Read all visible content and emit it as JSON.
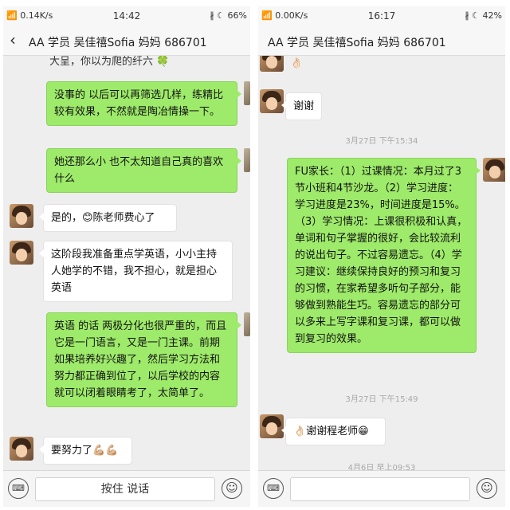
{
  "left": {
    "status": {
      "signal": "📶",
      "speed": "0.14K/s",
      "time": "14:42",
      "icons": "∦ ☾ 66%"
    },
    "title": "AA 学员 吴佳禧Sofia 妈妈 686701",
    "back_icon": "‹",
    "partial_top": "大呈，你以为爬的纤六 🍀",
    "messages": [
      {
        "side": "me",
        "text": "没事的 以后可以再筛选几样，练精比较有效果，不然就是陶冶情操一下。"
      },
      {
        "side": "me",
        "text": "她还那么小 也不太知道自己真的喜欢什么"
      },
      {
        "side": "them",
        "text": "是的，😊陈老师费心了"
      },
      {
        "side": "them",
        "text": "这阶段我准备重点学英语，小小主持人她学的不错，我不担心，就是担心英语"
      },
      {
        "side": "me",
        "text": "英语 的话 两极分化也很严重的，而且它是一门语言，又是一门主课。前期如果培养好兴趣了，然后学习方法和努力都正确到位了，以后学校的内容 就可以闭着眼睛考了，太简单了。"
      },
      {
        "side": "them",
        "text": "要努力了💪🏼💪🏼"
      }
    ],
    "input": {
      "hold_label": "按住 说话",
      "keyboard_icon": "⌨",
      "emoji_icon": "☺"
    }
  },
  "right": {
    "status": {
      "signal": "📶",
      "speed": "0.00K/s",
      "time": "16:17",
      "icons": "∦ ☾ 42%"
    },
    "title": "AA 学员 吴佳禧Sofia 妈妈 686701",
    "partial_top": "👌🏻",
    "messages": [
      {
        "side": "them",
        "text": "谢谢"
      },
      {
        "side": "me",
        "text": "FU家长：（1）过课情况：本月过了3节小班和4节沙龙。（2）学习进度：学习进度是23%，时间进度是15%。（3）学习情况：上课很积极和认真，单词和句子掌握的很好，会比较流利的说出句子。不过容易遗忘。（4）学习建议：继续保持良好的预习和复习的习惯，在家希望多听句子部分，能够做到熟能生巧。容易遗忘的部分可以多来上写字课和复习课，都可以做到复习的效果。"
      },
      {
        "side": "them",
        "text": "👌🏻谢谢程老师😁"
      }
    ],
    "timestamps": [
      "3月27日 下午15:34",
      "3月27日 下午15:49",
      "4月6日 早上09:53"
    ],
    "input": {
      "keyboard_icon": "⌨",
      "emoji_icon": "☺"
    }
  }
}
